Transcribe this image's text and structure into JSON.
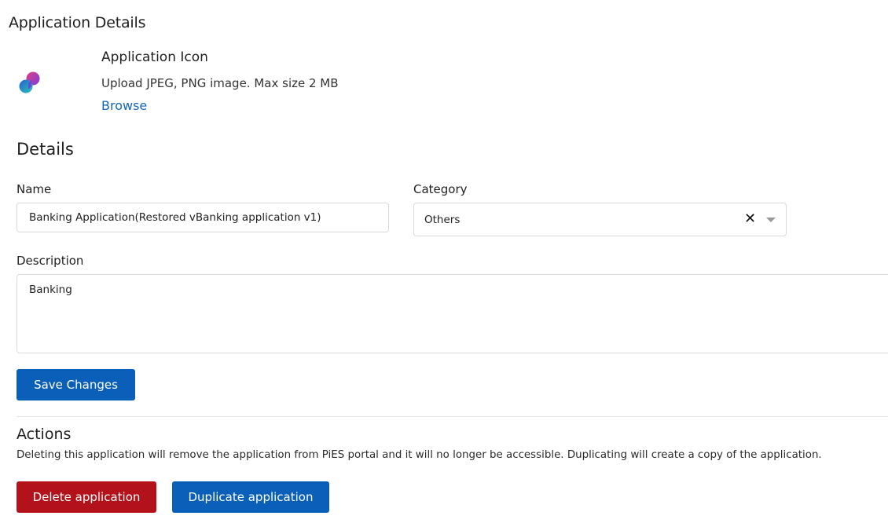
{
  "page": {
    "title": "Application Details"
  },
  "icon_section": {
    "title": "Application Icon",
    "hint": "Upload JPEG, PNG image. Max size 2 MB",
    "browse_label": "Browse",
    "icon": "app-logo-icon",
    "icon_colors": [
      "#e0407d",
      "#7c3ce0",
      "#2a5bd6",
      "#27c7b0"
    ]
  },
  "details": {
    "title": "Details",
    "name_label": "Name",
    "name_value": "Banking Application(Restored vBanking application v1)",
    "category_label": "Category",
    "category_value": "Others",
    "description_label": "Description",
    "description_value": "Banking",
    "save_label": "Save Changes"
  },
  "actions": {
    "title": "Actions",
    "text": "Deleting this application will remove the application from PiES portal and it will no longer be accessible. Duplicating will create a copy of the application.",
    "delete_label": "Delete application",
    "duplicate_label": "Duplicate application"
  },
  "colors": {
    "primary": "#0a60b8",
    "danger": "#b3121b",
    "link": "#1466b8"
  }
}
